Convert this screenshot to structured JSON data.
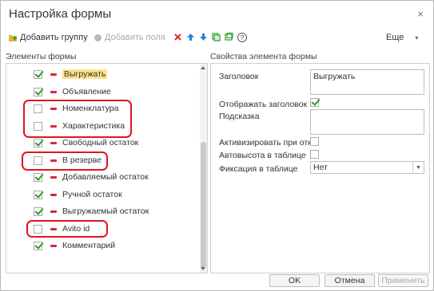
{
  "window": {
    "title": "Настройка формы",
    "close_label": "×"
  },
  "toolbar": {
    "add_group_label": "Добавить группу",
    "add_fields_label": "Добавить поля",
    "more_label": "Еще",
    "more_arrow": "▾",
    "icons": [
      "folder-add-icon",
      "add-fields-icon",
      "delete-icon",
      "move-up-icon",
      "move-down-icon",
      "copy-icon",
      "window-icon",
      "help-icon"
    ],
    "help_glyph": "?"
  },
  "left_panel": {
    "title": "Элементы формы"
  },
  "right_panel": {
    "title": "Свойства элемента формы"
  },
  "elements": [
    {
      "label": "Выгружать",
      "checked": true,
      "selected": true
    },
    {
      "label": "Объявление",
      "checked": true
    },
    {
      "label": "Номенклатура",
      "checked": false
    },
    {
      "label": "Характеристика",
      "checked": false
    },
    {
      "label": "Свободный остаток",
      "checked": true
    },
    {
      "label": "В резерве",
      "checked": false
    },
    {
      "label": "Добавляемый остаток",
      "checked": true
    },
    {
      "label": "Ручной остаток",
      "checked": true
    },
    {
      "label": "Выгружаемый остаток",
      "checked": true
    },
    {
      "label": "Avito id",
      "checked": false
    },
    {
      "label": "Комментарий",
      "checked": true
    }
  ],
  "properties": {
    "title_label": "Заголовок",
    "title_value": "Выгружать",
    "show_title_label": "Отображать заголовок",
    "show_title_checked": true,
    "hint_label": "Подсказка",
    "hint_value": "",
    "activate_label": "Активизировать при откры",
    "activate_checked": false,
    "autoheight_label": "Автовысота в таблице",
    "autoheight_checked": false,
    "fixation_label": "Фиксация в таблице",
    "fixation_value": "Нет",
    "dropdown_arrow": "▼"
  },
  "buttons": {
    "ok": "OK",
    "cancel": "Отмена",
    "apply": "Применить"
  },
  "colors": {
    "check": "#2a9d2a",
    "dash": "#d7283a",
    "highlight": "#fbe48a",
    "annotation": "#e0141e"
  }
}
